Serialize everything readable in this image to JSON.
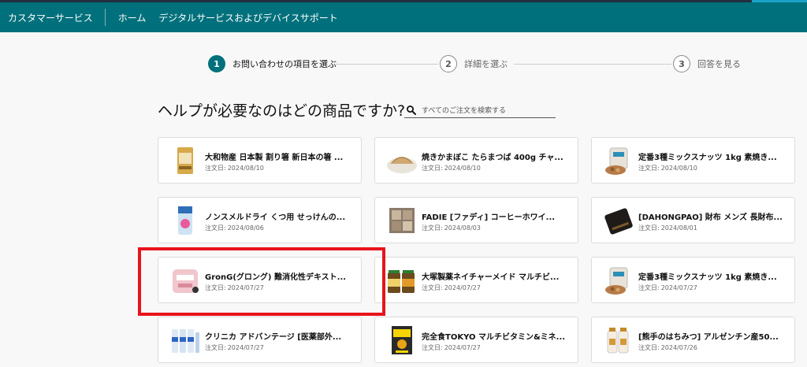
{
  "header": {
    "brand": "カスタマーサービス",
    "nav": [
      "ホーム",
      "デジタルサービスおよびデバイスサポート"
    ]
  },
  "stepper": {
    "steps": [
      {
        "number": "1",
        "label": "お問い合わせの項目を選ぶ",
        "active": true
      },
      {
        "number": "2",
        "label": "詳細を選ぶ",
        "active": false
      },
      {
        "number": "3",
        "label": "回答を見る",
        "active": false
      }
    ]
  },
  "main": {
    "heading": "ヘルプが必要なのはどの商品ですか?",
    "search_placeholder": "すべてのご注文を検索する",
    "date_prefix": "注文日:",
    "orders": [
      {
        "title": "大和物産 日本製 割り箸 新日本の箸 ...",
        "date": "2024/08/10",
        "thumb": "chopsticks-pack"
      },
      {
        "title": "焼きかまぼこ たらまつば 400g チャ...",
        "date": "2024/08/10",
        "thumb": "kamaboko-dish"
      },
      {
        "title": "定番3種ミックスナッツ 1kg 素焼き...",
        "date": "2024/08/10",
        "thumb": "mixed-nuts"
      },
      {
        "title": "ノンスメルドライ くつ用 せっけんの...",
        "date": "2024/08/06",
        "thumb": "shoe-deodorant"
      },
      {
        "title": "FADIE [ファディ] コーヒーホワイ...",
        "date": "2024/08/03",
        "thumb": "coffee-whitener"
      },
      {
        "title": "[DAHONGPAO] 財布 メンズ 長財布...",
        "date": "2024/08/01",
        "thumb": "wallet"
      },
      {
        "title": "GronG(グロング) 難消化性デキスト...",
        "date": "2024/07/27",
        "thumb": "dextrin-pouch"
      },
      {
        "title": "大塚製薬ネイチャーメイド マルチビ...",
        "date": "2024/07/27",
        "thumb": "vitamin-bottles"
      },
      {
        "title": "定番3種ミックスナッツ 1kg 素焼き...",
        "date": "2024/07/27",
        "thumb": "mixed-nuts"
      },
      {
        "title": "クリニカ アドバンテージ [医薬部外...",
        "date": "2024/07/27",
        "thumb": "toothpaste-tubes"
      },
      {
        "title": "完全食TOKYO マルチビタミン&ミネ...",
        "date": "2024/07/27",
        "thumb": "multivitamin-box"
      },
      {
        "title": "[熊手のはちみつ] アルゼンチン産50...",
        "date": "2024/07/26",
        "thumb": "honey-bottles"
      }
    ]
  },
  "colors": {
    "header_bg": "#00707c",
    "highlight_border": "#e8141c",
    "step_active": "#00707c"
  }
}
